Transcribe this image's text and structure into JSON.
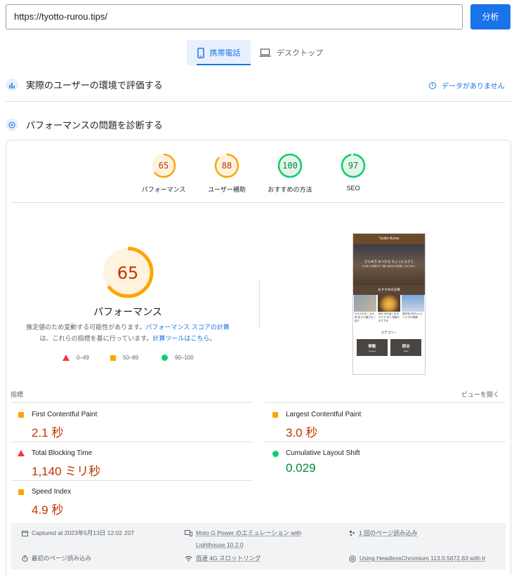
{
  "search": {
    "url": "https://tyotto-rurou.tips/",
    "analyze_label": "分析"
  },
  "tabs": {
    "mobile": "携帯電話",
    "desktop": "デスクトップ"
  },
  "field_data": {
    "title": "実際のユーザーの環境で評価する",
    "no_data": "データがありません"
  },
  "diagnose": {
    "title": "パフォーマンスの問題を診断する"
  },
  "scores": [
    {
      "label": "パフォーマンス",
      "value": "65",
      "score": 65,
      "color": "#ffa400",
      "text_color": "#c33300",
      "bg": "#fff3e0"
    },
    {
      "label": "ユーザー補助",
      "value": "88",
      "score": 88,
      "color": "#ffa400",
      "text_color": "#c33300",
      "bg": "#fff3e0"
    },
    {
      "label": "おすすめの方法",
      "value": "100",
      "score": 100,
      "color": "#0cce6b",
      "text_color": "#018642",
      "bg": "#e6f4ea"
    },
    {
      "label": "SEO",
      "value": "97",
      "score": 97,
      "color": "#0cce6b",
      "text_color": "#018642",
      "bg": "#e6f4ea"
    }
  ],
  "performance": {
    "score": "65",
    "title": "パフォーマンス",
    "note_a": "推定値のため変動する可能性があります。",
    "note_link1": "パフォーマンス スコアの計算",
    "note_b": "は、これらの指標を基に行っています。",
    "note_link2": "計算ツールはこちら",
    "note_end": "。"
  },
  "legend": {
    "poor": "0–49",
    "average": "50–89",
    "good": "90–100"
  },
  "preview": {
    "site_title": "Tyotto Rurou",
    "hero_line1": "ひらめき みつかる ちょっとるろう",
    "hero_line2": "ひらめいた場所まで一緒にお出かけを応援しております。",
    "recommended": "おすすめの記事",
    "card1": "からのおまこの大阪 旅 行の魅力をご紹介",
    "card2": "読め 来を楽しめるのすす めで 旅路のおすすめ",
    "card3": "鹿児島の特ちゃ山とタ 日が素敵",
    "category": "カテゴリー",
    "cat1": "移動",
    "cat1_sub": "moving",
    "cat2": "宿泊",
    "cat2_sub": "hotel"
  },
  "metrics": {
    "label": "指標",
    "expand": "ビューを開く",
    "items": [
      {
        "name": "First Contentful Paint",
        "value": "2.1 秒",
        "status": "average"
      },
      {
        "name": "Largest Contentful Paint",
        "value": "3.0 秒",
        "status": "average"
      },
      {
        "name": "Total Blocking Time",
        "value": "1,140 ミリ秒",
        "status": "poor"
      },
      {
        "name": "Cumulative Layout Shift",
        "value": "0.029",
        "status": "good"
      },
      {
        "name": "Speed Index",
        "value": "4.9 秒",
        "status": "average"
      }
    ]
  },
  "run_info": {
    "captured": "Captured at 2023年5月13日 12:02 JST",
    "device_line1": "Moto G Power のエミュレーション with",
    "device_line2": "Lighthouse 10.2.0",
    "session": "1 回のページ読み込み",
    "initial_load": "最初のページ読み込み",
    "throttling": "低速 4G スロットリング",
    "browser": "Using HeadlessChromium 113.0.5672.63 with lr"
  }
}
